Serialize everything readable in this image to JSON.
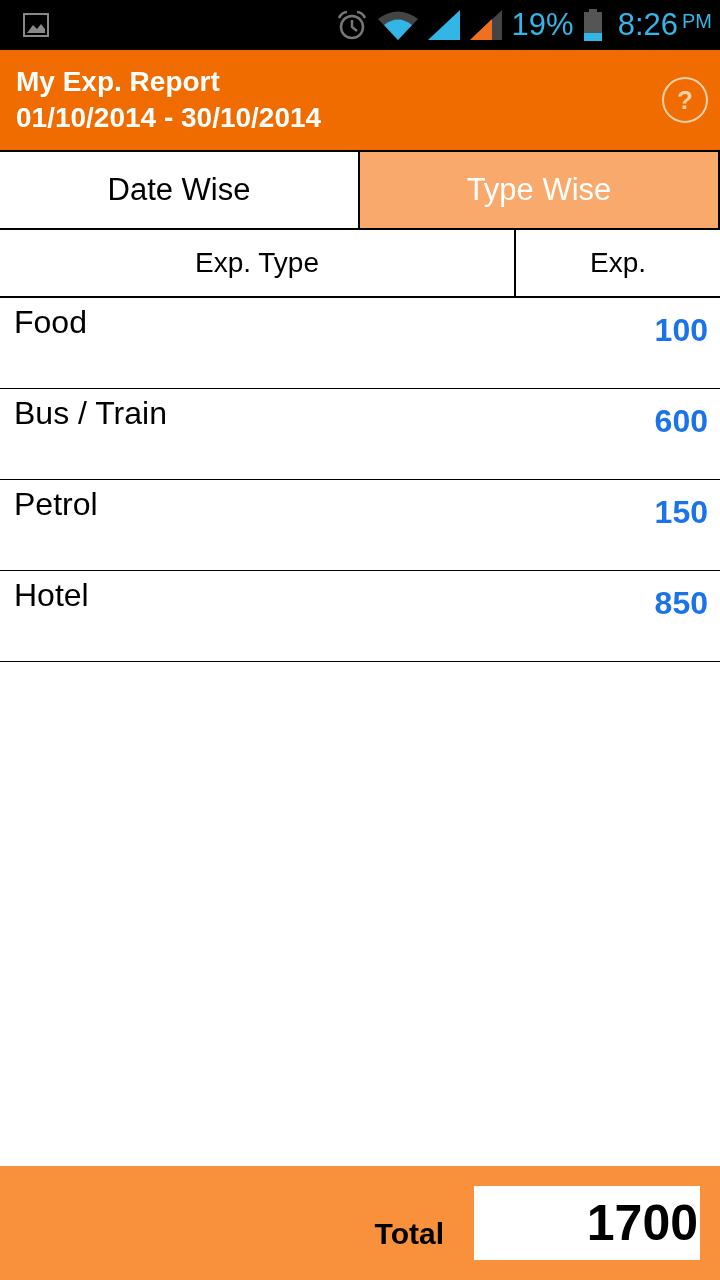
{
  "status_bar": {
    "battery_percent": "19%",
    "time": "8:26",
    "ampm": "PM"
  },
  "header": {
    "title": "My Exp. Report",
    "date_range": "01/10/2014 - 30/10/2014",
    "help": "?"
  },
  "tabs": [
    {
      "label": "Date Wise",
      "selected": false
    },
    {
      "label": "Type Wise",
      "selected": true
    }
  ],
  "table": {
    "columns": [
      "Exp. Type",
      "Exp."
    ],
    "rows": [
      {
        "type": "Food",
        "amount": "100"
      },
      {
        "type": "Bus / Train",
        "amount": "600"
      },
      {
        "type": "Petrol",
        "amount": "150"
      },
      {
        "type": "Hotel",
        "amount": "850"
      }
    ]
  },
  "footer": {
    "label": "Total",
    "value": "1700"
  }
}
